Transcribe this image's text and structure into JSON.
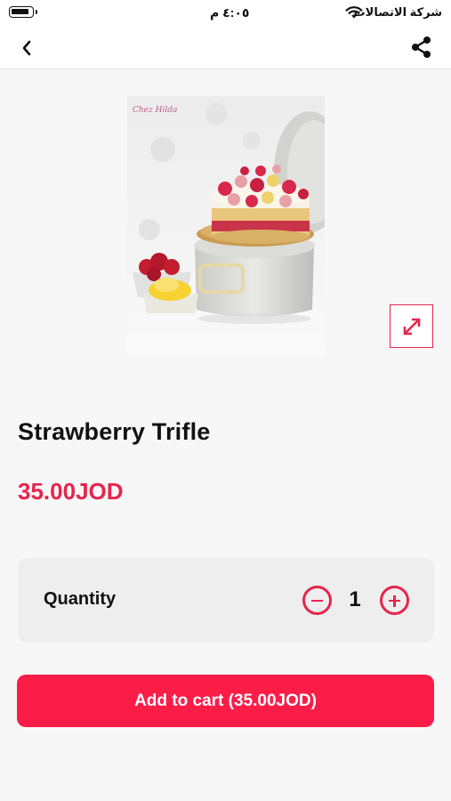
{
  "status_bar": {
    "time": "٤:٠٥ م",
    "carrier": "شركة الاتصالات"
  },
  "product": {
    "title": "Strawberry Trifle",
    "price": "35.00JOD",
    "image_logo_text": "Chez Hilda"
  },
  "quantity": {
    "label": "Quantity",
    "value": "1"
  },
  "cart": {
    "add_label": "Add to cart (35.00JOD)"
  },
  "icons": {
    "back": "chevron-left-icon",
    "share": "share-icon",
    "expand": "expand-icon",
    "minus": "minus-circle-icon",
    "plus": "plus-circle-icon"
  },
  "colors": {
    "accent": "#e8244c",
    "button": "#fc1c48",
    "card": "#eeeeee",
    "background": "#f7f7f7"
  }
}
